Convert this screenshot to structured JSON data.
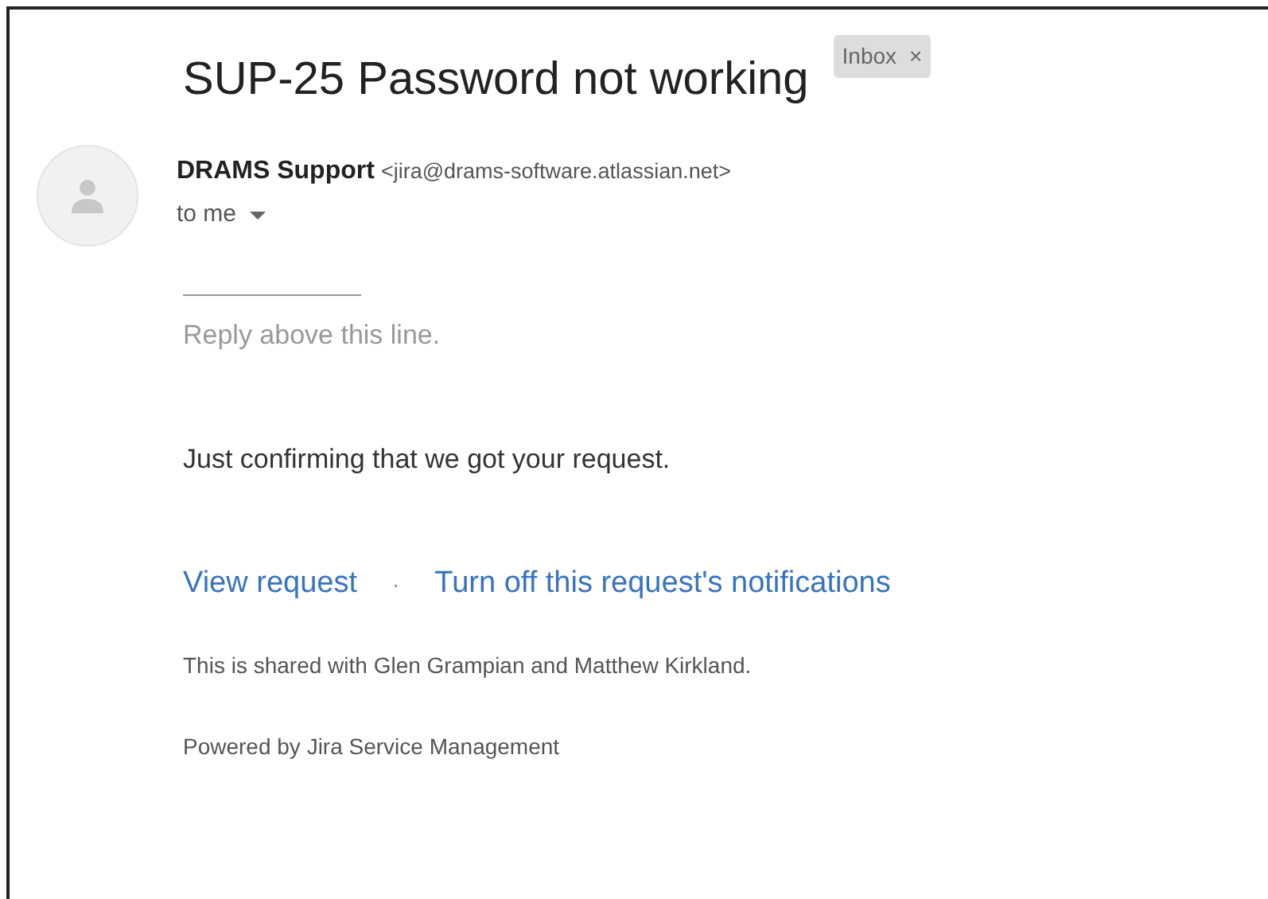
{
  "subject": "SUP-25 Password not working",
  "label": {
    "text": "Inbox",
    "remove": "×"
  },
  "sender": {
    "name": "DRAMS Support",
    "email": "<jira@drams-software.atlassian.net>",
    "recipient": "to me"
  },
  "body": {
    "hint": "Reply above this line.",
    "message": "Just confirming that we got your request.",
    "links": [
      "View request",
      "Turn off this request's notifications"
    ],
    "separator": "·",
    "shared": "This is shared with Glen Grampian and Matthew Kirkland.",
    "footer": "Powered by Jira Service Management"
  }
}
